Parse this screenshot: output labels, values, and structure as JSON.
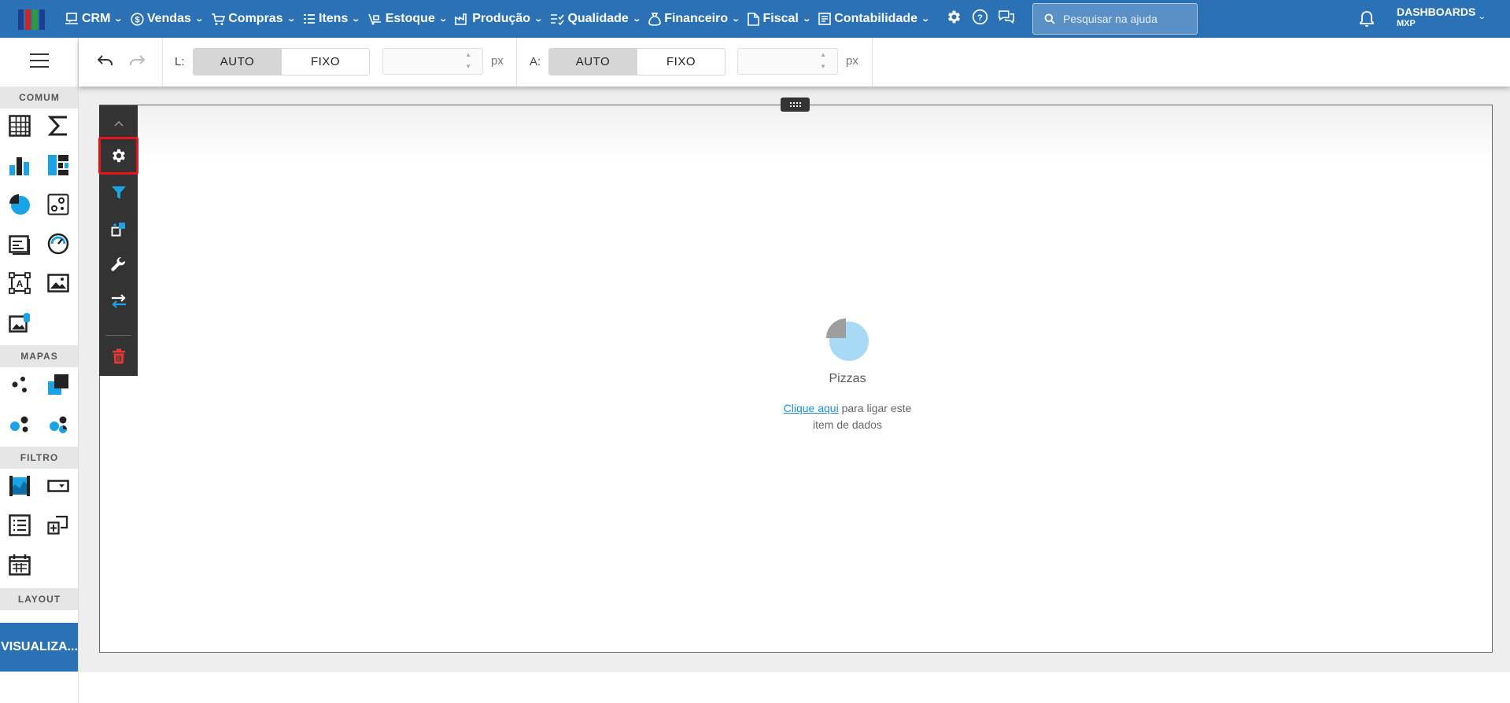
{
  "colors": {
    "topbar": "#2b71b5",
    "accent": "#1aa4e6",
    "danger": "#e53935",
    "selected_outline": "#e8141b"
  },
  "nav": {
    "items": [
      {
        "label": "CRM",
        "icon": "crm-icon"
      },
      {
        "label": "Vendas",
        "icon": "dollar-icon"
      },
      {
        "label": "Compras",
        "icon": "cart-icon"
      },
      {
        "label": "Itens",
        "icon": "items-icon"
      },
      {
        "label": "Estoque",
        "icon": "stock-icon"
      },
      {
        "label": "Produção",
        "icon": "factory-icon"
      },
      {
        "label": "Qualidade",
        "icon": "checklist-icon"
      },
      {
        "label": "Financeiro",
        "icon": "money-bag-icon"
      },
      {
        "label": "Fiscal",
        "icon": "document-icon"
      },
      {
        "label": "Contabilidade",
        "icon": "ledger-icon"
      }
    ]
  },
  "search": {
    "placeholder": "Pesquisar na ajuda"
  },
  "user": {
    "dashboard": "DASHBOARDS",
    "company": "MXP"
  },
  "sidebar": {
    "sections": [
      "COMUM",
      "MAPAS",
      "FILTRO",
      "LAYOUT"
    ],
    "visualize_label": "VISUALIZA..."
  },
  "toolbar": {
    "width_label": "L:",
    "height_label": "A:",
    "auto_label": "AUTO",
    "fixed_label": "FIXO",
    "unit": "px",
    "width_value": "",
    "height_value": ""
  },
  "widget": {
    "title": "Pizzas",
    "link_text": "Clique aqui",
    "text_rest": " para ligar este",
    "text_line2": "item de dados"
  }
}
